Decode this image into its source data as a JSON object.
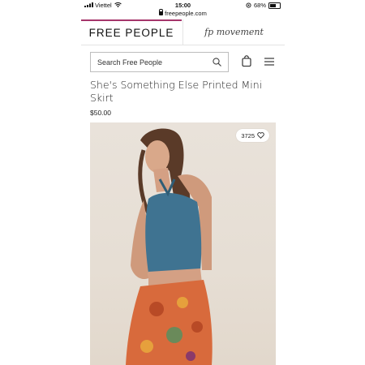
{
  "status_bar": {
    "carrier": "Viettel",
    "time": "15:00",
    "battery": "68%",
    "url": "freepeople.com"
  },
  "brand_tabs": {
    "primary": "FREE PEOPLE",
    "secondary": "fp movement"
  },
  "search": {
    "placeholder": "Search Free People"
  },
  "icons": {
    "search": "search-icon",
    "bag": "shopping-bag-icon",
    "menu": "hamburger-menu-icon",
    "favorite": "heart-icon"
  },
  "product": {
    "title": "She's Something Else Printed Mini Skirt",
    "price": "$50.00",
    "favorites_count": "3725"
  },
  "colors": {
    "accent": "#a5356b",
    "top": "#3f7391",
    "skirt": "#d86a3c"
  }
}
